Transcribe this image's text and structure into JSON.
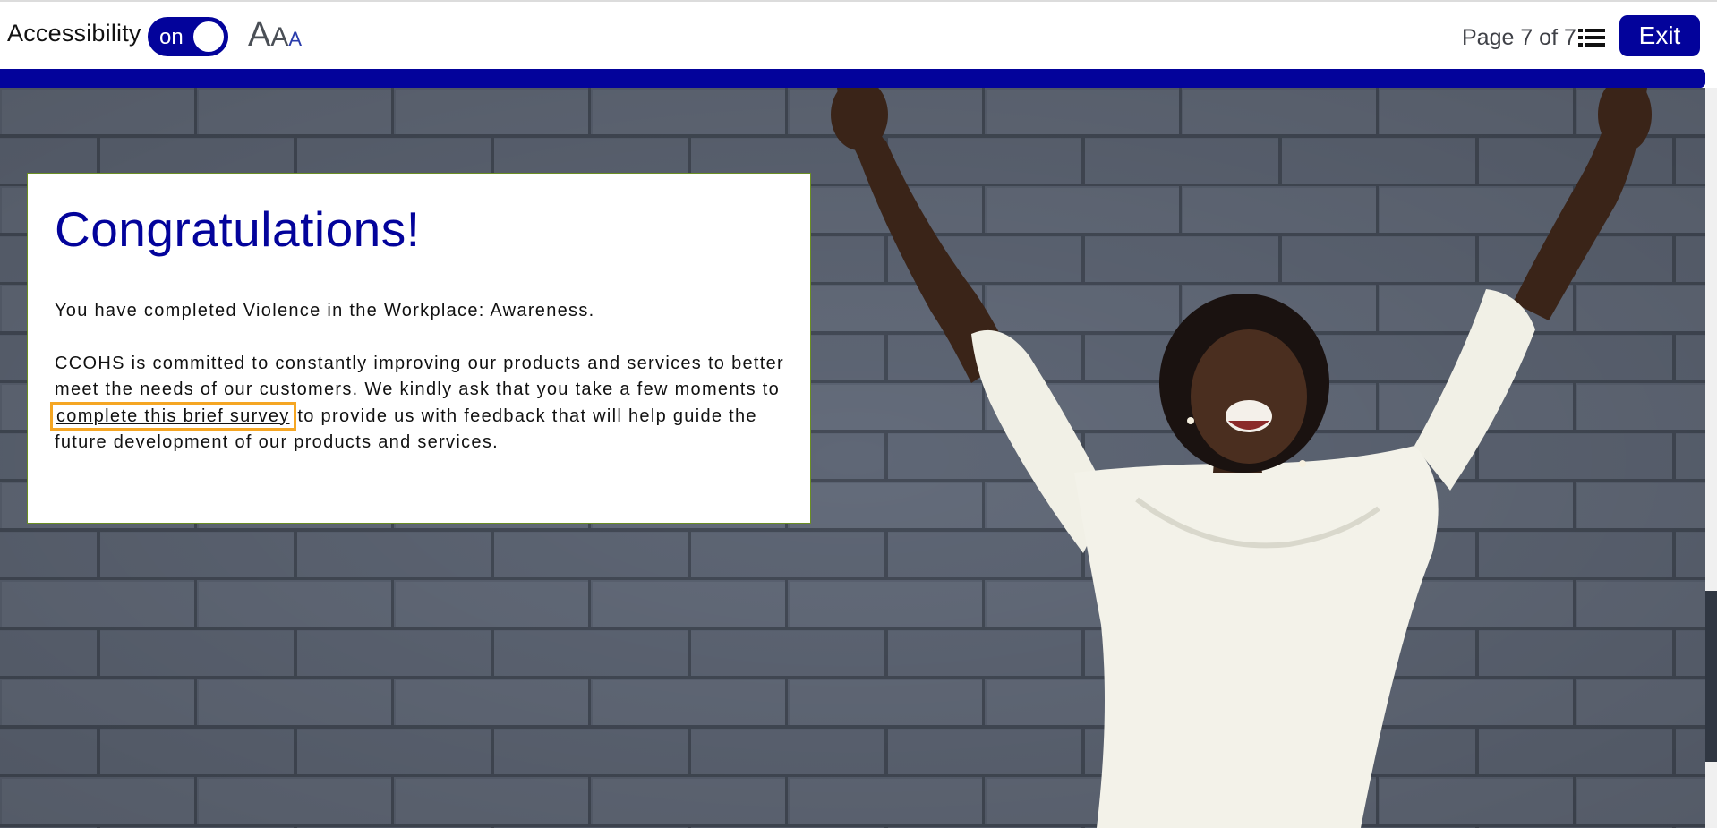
{
  "topbar": {
    "accessibility_label": "Accessibility",
    "toggle_state": "on",
    "text_size_glyphs": [
      "A",
      "A",
      "A"
    ],
    "page_indicator": "Page 7 of 7",
    "exit_label": "Exit",
    "menu_icon": "list-icon"
  },
  "progress": {
    "fraction": 1.0
  },
  "card": {
    "title": "Congratulations!",
    "completion_text": "You have completed Violence in the Workplace: Awareness.",
    "survey_prefix": "CCOHS is committed to constantly improving our products and services to better meet the needs of our customers. We kindly ask that you take a few moments to ",
    "survey_link": "complete this brief survey",
    "survey_suffix": " to provide us with feedback that will help guide the future development of our products and services."
  },
  "colors": {
    "brand": "#03039b",
    "focus_outline": "#f5a623",
    "card_border": "#6b8e23"
  }
}
